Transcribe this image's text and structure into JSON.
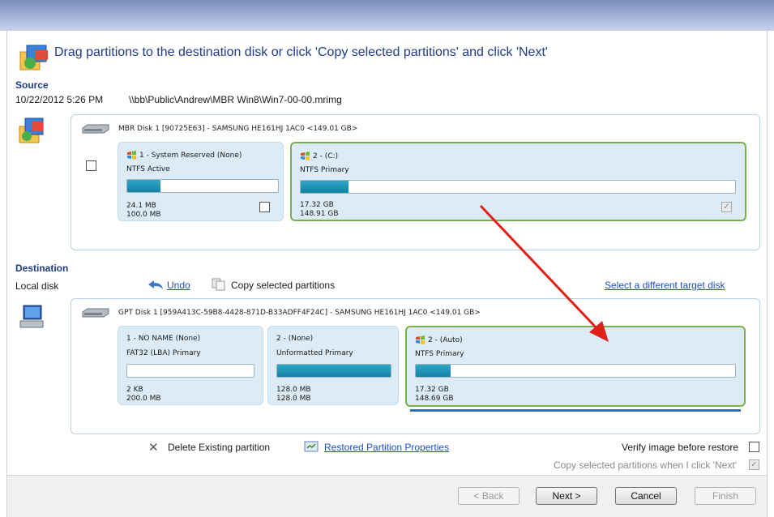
{
  "header": {
    "instruction": "Drag partitions to the destination disk or click 'Copy selected partitions' and click 'Next'"
  },
  "source": {
    "label": "Source",
    "datetime": "10/22/2012 5:26 PM",
    "path": "\\\\bb\\Public\\Andrew\\MBR Win8\\Win7-00-00.mrimg",
    "disk_title": "MBR Disk 1 [90725E63] - SAMSUNG  HE161HJ         1AC0  <149.01 GB>",
    "partitions": [
      {
        "name": "1 - System Reserved (None)",
        "fs": "NTFS Active",
        "used": "24.1 MB",
        "total": "100.0 MB",
        "fill": 0.22,
        "checked": false
      },
      {
        "name": "2 - (C:)",
        "fs": "NTFS Primary",
        "used": "17.32 GB",
        "total": "148.91 GB",
        "fill": 0.11,
        "checked": true
      }
    ]
  },
  "destination": {
    "label": "Destination",
    "sublabel": "Local disk",
    "undo_label": "Undo",
    "copy_label": "Copy selected partitions",
    "select_target_label": "Select a different target disk",
    "disk_title": "GPT Disk 1 [959A413C-59B8-4428-871D-B33ADFF4F24C] - SAMSUNG  HE161HJ         1AC0  <149.01 GB>",
    "partitions": [
      {
        "name": "1 - NO NAME (None)",
        "fs": "FAT32 (LBA) Primary",
        "used": "2 KB",
        "total": "200.0 MB",
        "fill": 0.0
      },
      {
        "name": "2 - (None)",
        "fs": "Unformatted Primary",
        "used": "128.0 MB",
        "total": "128.0 MB",
        "fill": 1.0
      },
      {
        "name": "2 - (Auto)",
        "fs": "NTFS Primary",
        "used": "17.32 GB",
        "total": "148.69 GB",
        "fill": 0.11
      }
    ]
  },
  "actions": {
    "delete_label": "Delete Existing partition",
    "properties_label": "Restored Partition Properties",
    "verify_label": "Verify image before restore",
    "copy_on_next_label": "Copy selected partitions when I click 'Next'"
  },
  "buttons": {
    "back": "< Back",
    "next": "Next >",
    "cancel": "Cancel",
    "finish": "Finish"
  },
  "colors": {
    "accent_text": "#1f3c88",
    "partition_bg": "#dcebf6",
    "selected_border": "#78b04e",
    "bar_fill": "#1382a6",
    "arrow": "#e0201b"
  }
}
